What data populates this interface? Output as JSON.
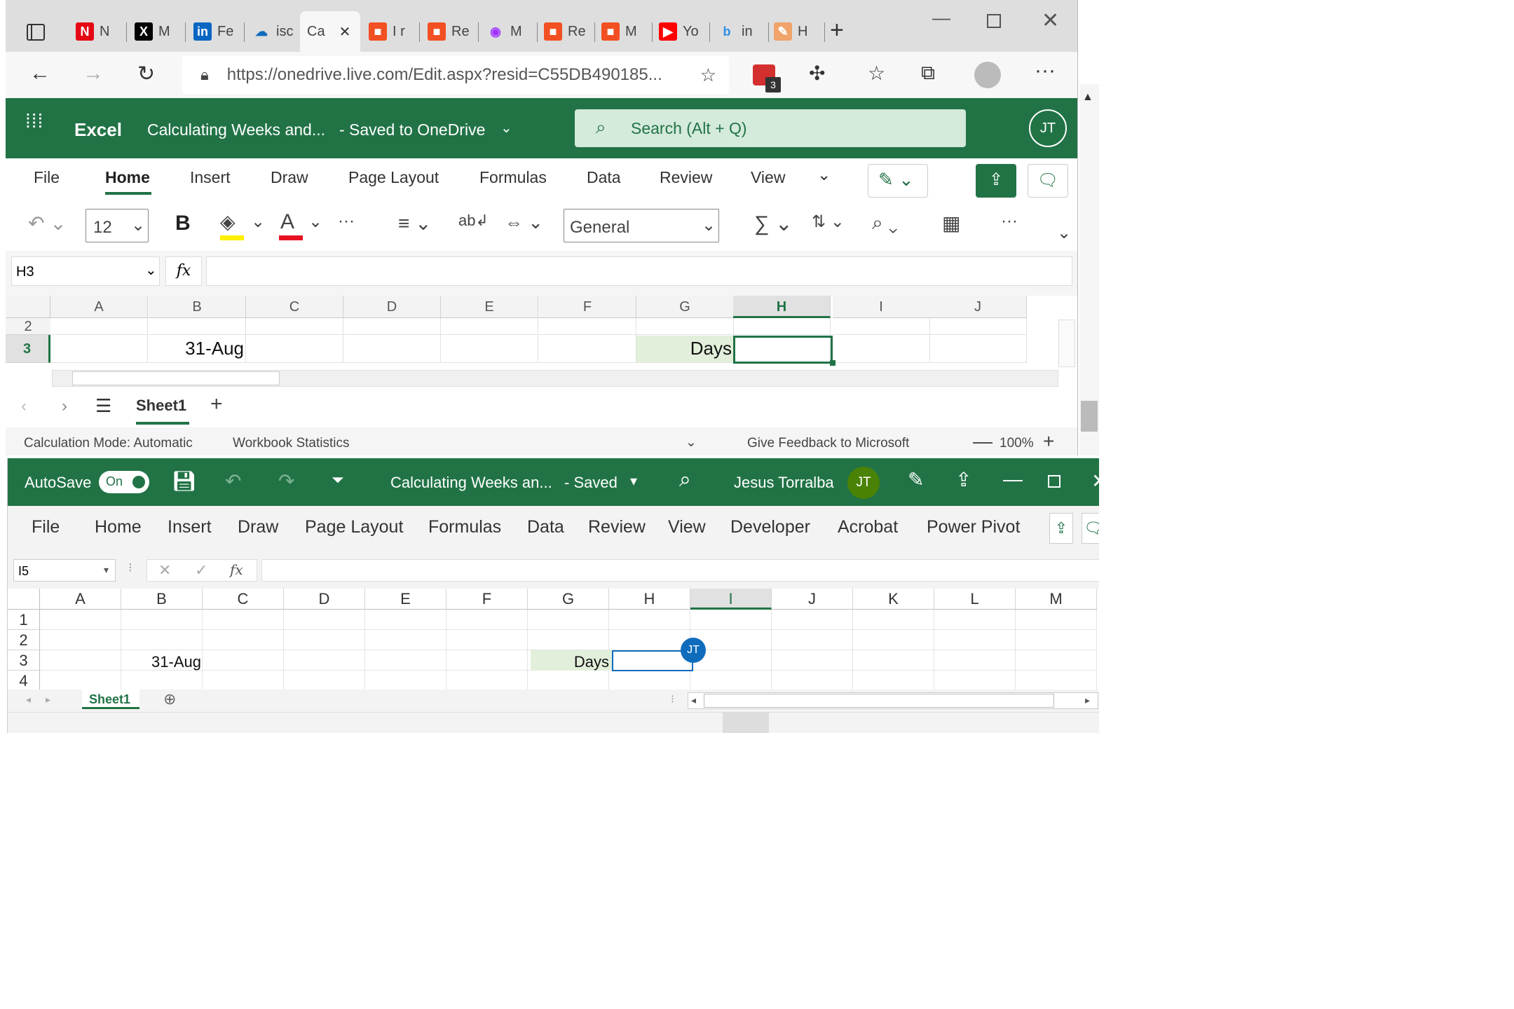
{
  "browser": {
    "tabs": [
      {
        "label": "N",
        "icon": "netflix-icon",
        "color": "#e50914",
        "glyph": "N"
      },
      {
        "label": "M",
        "icon": "x-icon",
        "color": "#000000",
        "glyph": "X"
      },
      {
        "label": "Fe",
        "icon": "linkedin-icon",
        "color": "#0a66c2",
        "glyph": "in"
      },
      {
        "label": "isc",
        "icon": "onedrive-icon",
        "color": "#0f6cbd",
        "glyph": "☁"
      },
      {
        "label": "Ca",
        "icon": "excel-tab-icon",
        "color": "#f7f7f7",
        "glyph": ""
      },
      {
        "label": "I r",
        "icon": "microsoft-icon",
        "color": "#f25022",
        "glyph": "■"
      },
      {
        "label": "Re",
        "icon": "microsoft-icon",
        "color": "#f25022",
        "glyph": "■"
      },
      {
        "label": "M",
        "icon": "messenger-icon",
        "color": "#a033ff",
        "glyph": "◉"
      },
      {
        "label": "Re",
        "icon": "microsoft-icon",
        "color": "#f25022",
        "glyph": "■"
      },
      {
        "label": "M",
        "icon": "microsoft-icon",
        "color": "#f25022",
        "glyph": "■"
      },
      {
        "label": "Yo",
        "icon": "youtube-icon",
        "color": "#ff0000",
        "glyph": "▶"
      },
      {
        "label": "in",
        "icon": "bing-icon",
        "color": "#2f8ee6",
        "glyph": "b"
      },
      {
        "label": "H",
        "icon": "pencil-tab-icon",
        "color": "#f0a36a",
        "glyph": "✎"
      }
    ],
    "url": "https://onedrive.live.com/Edit.aspx?resid=C55DB490185...",
    "extension_badge": "3"
  },
  "web_excel": {
    "app_name": "Excel",
    "doc_title": "Calculating Weeks and...",
    "save_status": "-  Saved to OneDrive",
    "search_placeholder": "Search (Alt + Q)",
    "user_initials": "JT",
    "tabs": [
      "File",
      "Home",
      "Insert",
      "Draw",
      "Page Layout",
      "Formulas",
      "Data",
      "Review",
      "View"
    ],
    "active_tab": "Home",
    "font_size": "12",
    "number_format": "General",
    "name_box": "H3",
    "fx": "fx",
    "columns": [
      "A",
      "B",
      "C",
      "D",
      "E",
      "F",
      "G",
      "H",
      "I",
      "J"
    ],
    "rows": [
      "2",
      "3"
    ],
    "cell_B3": "31-Aug",
    "cell_G3": "Days",
    "sheet": "Sheet1",
    "status_calc": "Calculation Mode: Automatic",
    "status_stats": "Workbook Statistics",
    "feedback": "Give Feedback to Microsoft",
    "zoom": "100%"
  },
  "desktop_excel": {
    "autosave_label": "AutoSave",
    "autosave_state": "On",
    "doc_title": "Calculating Weeks an...",
    "save_status": "-  Saved",
    "user_name": "Jesus Torralba",
    "user_initials": "JT",
    "tabs": [
      "File",
      "Home",
      "Insert",
      "Draw",
      "Page Layout",
      "Formulas",
      "Data",
      "Review",
      "View",
      "Developer",
      "Acrobat",
      "Power Pivot"
    ],
    "name_box": "I5",
    "fx": "fx",
    "columns": [
      "A",
      "B",
      "C",
      "D",
      "E",
      "F",
      "G",
      "H",
      "I",
      "J",
      "K",
      "L",
      "M"
    ],
    "rows": [
      "1",
      "2",
      "3",
      "4"
    ],
    "cell_B3": "31-Aug",
    "cell_G3": "Days",
    "presence_initials": "JT",
    "sheet": "Sheet1"
  }
}
